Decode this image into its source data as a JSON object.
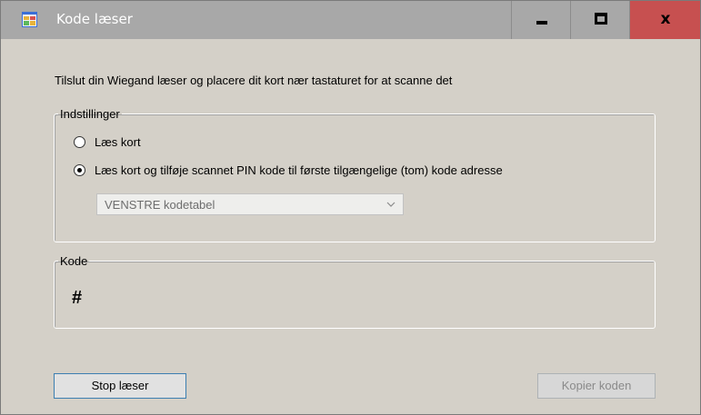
{
  "window": {
    "title": "Kode læser",
    "controls": {
      "minimize": "minimize",
      "maximize": "maximize",
      "close": "x"
    }
  },
  "instruction": "Tilslut din Wiegand læser og placere dit kort nær tastaturet for at scanne det",
  "settings": {
    "legend": "Indstillinger",
    "options": [
      {
        "label": "Læs kort",
        "checked": false
      },
      {
        "label": "Læs kort og tilføje scannet PIN kode til første tilgængelige (tom) kode adresse",
        "checked": true
      }
    ],
    "table_select": {
      "value": "VENSTRE kodetabel",
      "enabled": false
    }
  },
  "code": {
    "legend": "Kode",
    "value": "#"
  },
  "buttons": {
    "stop": "Stop læser",
    "copy": "Kopier koden"
  },
  "colors": {
    "titlebar": "#a8a8a8",
    "close": "#c75050",
    "dialog": "#d4d0c8",
    "button_focus_border": "#3c7fb1"
  },
  "icons": {
    "app": "app-window-icon",
    "combo_arrow": "chevron-down-icon"
  }
}
